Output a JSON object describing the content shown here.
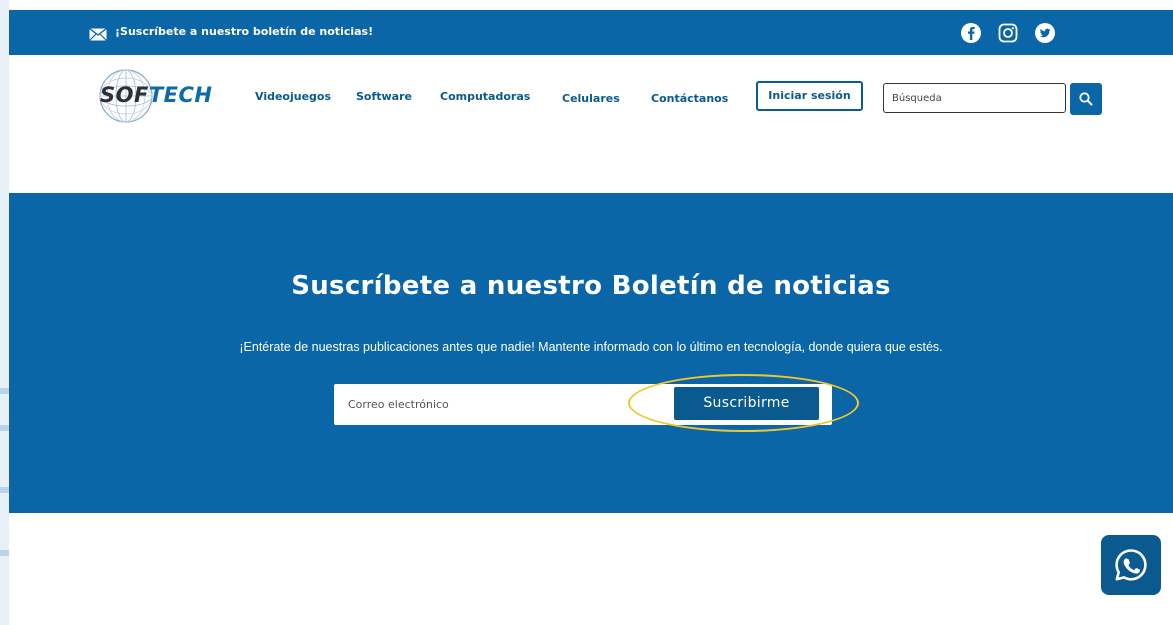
{
  "topbar": {
    "promo_text": "¡Suscríbete a nuestro boletín de noticias!",
    "icons": [
      "mail-icon",
      "facebook-icon",
      "instagram-icon",
      "twitter-icon"
    ]
  },
  "header": {
    "logo": {
      "part1": "SOF",
      "part2": "TECH"
    },
    "nav": [
      "Videojuegos",
      "Software",
      "Computadoras",
      "Celulares",
      "Contáctanos"
    ],
    "login_label": "Iniciar sesión",
    "search_placeholder": "Búsqueda"
  },
  "hero": {
    "title": "Suscríbete a nuestro Boletín de noticias",
    "subtitle": "¡Entérate de nuestras publicaciones antes que nadie! Mantente informado con lo último en tecnología, donde quiera que estés.",
    "email_placeholder": "Correo electrónico",
    "subscribe_label": "Suscribirme"
  },
  "colors": {
    "primary": "#0b66a8",
    "dark_blue": "#0b5a8f",
    "highlight": "#f3c62c"
  }
}
